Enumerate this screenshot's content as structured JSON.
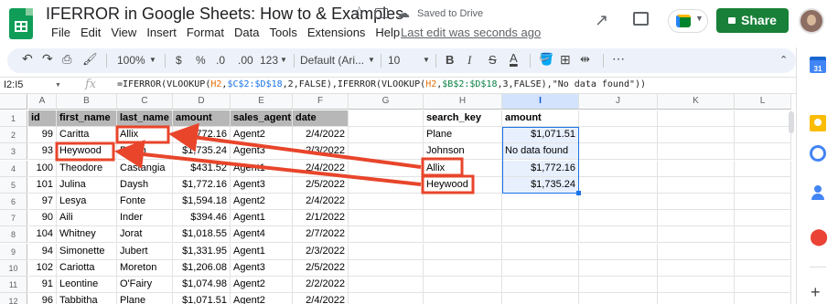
{
  "app": {
    "title": "IFERROR in Google Sheets: How to & Examples",
    "saved_status": "Saved to Drive",
    "last_edit": "Last edit was seconds ago",
    "share_label": "Share"
  },
  "menu": [
    "File",
    "Edit",
    "View",
    "Insert",
    "Format",
    "Data",
    "Tools",
    "Extensions",
    "Help"
  ],
  "toolbar": {
    "zoom": "100%",
    "currency": "$",
    "percent": "%",
    "dec_decrease": ".0",
    "dec_increase": ".00",
    "more_formats": "123",
    "font": "Default (Ari...",
    "font_size": "10",
    "bold": "B",
    "italic": "I",
    "strike": "S",
    "text_color": "A",
    "more": "⋯"
  },
  "formula_bar": {
    "name_box": "I2:I5",
    "fx": "fx",
    "parts": [
      {
        "text": "=IFERROR(VLOOKUP(",
        "cls": ""
      },
      {
        "text": "H2",
        "cls": "r1"
      },
      {
        "text": ",",
        "cls": ""
      },
      {
        "text": "$C$2:$D$18",
        "cls": "r2"
      },
      {
        "text": ",2,FALSE),IFERROR(VLOOKUP(",
        "cls": ""
      },
      {
        "text": "H2",
        "cls": "r1"
      },
      {
        "text": ",",
        "cls": ""
      },
      {
        "text": "$B$2:$D$18",
        "cls": "r3"
      },
      {
        "text": ",3,FALSE),\"No data found\"))",
        "cls": ""
      }
    ]
  },
  "sheet": {
    "columns": [
      "A",
      "B",
      "C",
      "D",
      "E",
      "F",
      "G",
      "H",
      "I",
      "J",
      "K",
      "L"
    ],
    "row_numbers": [
      "1",
      "2",
      "3",
      "4",
      "5",
      "6",
      "7",
      "8",
      "9",
      "10",
      "11",
      "12"
    ],
    "headers": [
      "id",
      "first_name",
      "last_name",
      "amount",
      "sales_agent",
      "date"
    ],
    "rows": [
      [
        "99",
        "Caritta",
        "Allix",
        "$1,772.16",
        "Agent2",
        "2/4/2022"
      ],
      [
        "93",
        "Heywood",
        "Paton",
        "$1,735.24",
        "Agent3",
        "2/3/2022"
      ],
      [
        "100",
        "Theodore",
        "Castangia",
        "$431.52",
        "Agent1",
        "2/4/2022"
      ],
      [
        "101",
        "Julina",
        "Daysh",
        "$1,772.16",
        "Agent3",
        "2/5/2022"
      ],
      [
        "97",
        "Lesya",
        "Fonte",
        "$1,594.18",
        "Agent2",
        "2/4/2022"
      ],
      [
        "90",
        "Aili",
        "Inder",
        "$394.46",
        "Agent1",
        "2/1/2022"
      ],
      [
        "104",
        "Whitney",
        "Jorat",
        "$1,018.55",
        "Agent4",
        "2/7/2022"
      ],
      [
        "94",
        "Simonette",
        "Jubert",
        "$1,331.95",
        "Agent1",
        "2/3/2022"
      ],
      [
        "102",
        "Cariotta",
        "Moreton",
        "$1,206.08",
        "Agent3",
        "2/5/2022"
      ],
      [
        "91",
        "Leontine",
        "O'Fairy",
        "$1,074.98",
        "Agent2",
        "2/2/2022"
      ],
      [
        "96",
        "Tabbitha",
        "Plane",
        "$1,071.51",
        "Agent2",
        "2/4/2022"
      ]
    ],
    "lookup": {
      "h_header": "search_key",
      "i_header": "amount",
      "keys": [
        "Plane",
        "Johnson",
        "Allix",
        "Heywood"
      ],
      "results": [
        "$1,071.51",
        "No data found",
        "$1,772.16",
        "$1,735.24"
      ]
    }
  },
  "sidepanel": {
    "calendar_label": "31",
    "plus": "+"
  },
  "colors": {
    "annotation_red": "#e8452b",
    "selection_blue": "#1a73e8",
    "share_green": "#188038"
  }
}
